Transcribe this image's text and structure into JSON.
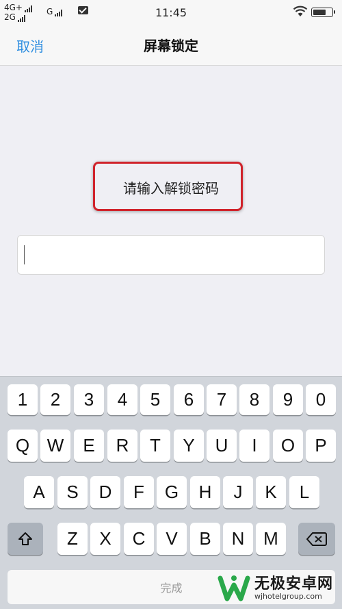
{
  "status_bar": {
    "network_1": "4G+",
    "network_2": "2G",
    "network_3": "G",
    "time": "11:45"
  },
  "nav": {
    "cancel_label": "取消",
    "title": "屏幕锁定"
  },
  "content": {
    "prompt": "请输入解锁密码",
    "password_value": ""
  },
  "keyboard": {
    "number_row": [
      "1",
      "2",
      "3",
      "4",
      "5",
      "6",
      "7",
      "8",
      "9",
      "0"
    ],
    "row1": [
      "Q",
      "W",
      "E",
      "R",
      "T",
      "Y",
      "U",
      "I",
      "O",
      "P"
    ],
    "row2": [
      "A",
      "S",
      "D",
      "F",
      "G",
      "H",
      "J",
      "K",
      "L"
    ],
    "row3": [
      "Z",
      "X",
      "C",
      "V",
      "B",
      "N",
      "M"
    ],
    "done_label": "完成"
  },
  "watermark": {
    "title": "无极安卓网",
    "subtitle": "wjhotelgroup.com"
  },
  "colors": {
    "accent": "#2f8ee0",
    "highlight_border": "#d0232b",
    "keyboard_bg": "#d1d5db"
  }
}
